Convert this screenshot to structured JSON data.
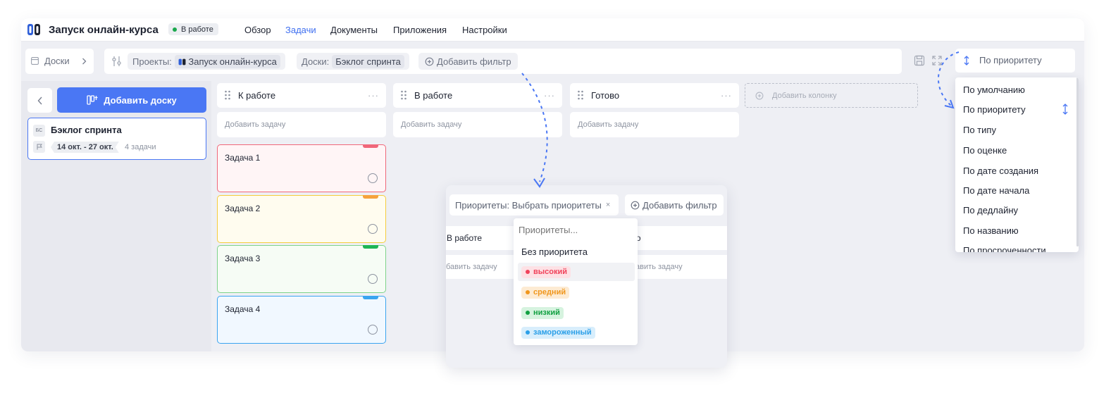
{
  "header": {
    "project_title": "Запуск онлайн-курса",
    "status": "В работе",
    "nav": [
      "Обзор",
      "Задачи",
      "Документы",
      "Приложения",
      "Настройки"
    ],
    "active_nav": "Задачи"
  },
  "toolbar": {
    "boards_label": "Доски",
    "filter_projects_key": "Проекты:",
    "filter_projects_value": "Запуск онлайн-курса",
    "filter_boards_key": "Доски:",
    "filter_boards_value": "Бэклог спринта",
    "add_filter": "Добавить фильтр",
    "sort_current": "По приоритету"
  },
  "sidebar": {
    "add_board": "Добавить доску",
    "board": {
      "abbr": "БС",
      "name": "Бэклог спринта",
      "dates": "14 окт. - 27 окт.",
      "count": "4 задачи"
    }
  },
  "columns": [
    {
      "name": "К работе",
      "add_task": "Добавить задачу"
    },
    {
      "name": "В работе",
      "add_task": "Добавить задачу"
    },
    {
      "name": "Готово",
      "add_task": "Добавить задачу"
    }
  ],
  "add_column": "Добавить колонку",
  "tasks": [
    {
      "title": "Задача 1",
      "priority_color": "#f0677a"
    },
    {
      "title": "Задача 2",
      "priority_color": "#f5a23d"
    },
    {
      "title": "Задача 3",
      "priority_color": "#1eb556"
    },
    {
      "title": "Задача 4",
      "priority_color": "#3aa4f0"
    }
  ],
  "sort_menu": [
    "По умолчанию",
    "По приоритету",
    "По типу",
    "По оценке",
    "По дате создания",
    "По дате начала",
    "По дедлайну",
    "По названию",
    "По просроченности"
  ],
  "popup": {
    "priority_filter": "Приоритеты: Выбрать приоритеты",
    "add_filter": "Добавить фильтр",
    "col_left": "В работе",
    "col_right": "ово",
    "add_left": "бавить задачу",
    "add_right": "бавить задачу",
    "search_placeholder": "Приоритеты...",
    "no_priority": "Без приоритета",
    "priorities": [
      {
        "label": "высокий",
        "color": "#f0435b",
        "bg": "#fde1e5"
      },
      {
        "label": "средний",
        "color": "#f0961c",
        "bg": "#fdebd3"
      },
      {
        "label": "низкий",
        "color": "#11a041",
        "bg": "#d6f3df"
      },
      {
        "label": "замороженный",
        "color": "#2b9fe8",
        "bg": "#d8eefc"
      }
    ]
  }
}
